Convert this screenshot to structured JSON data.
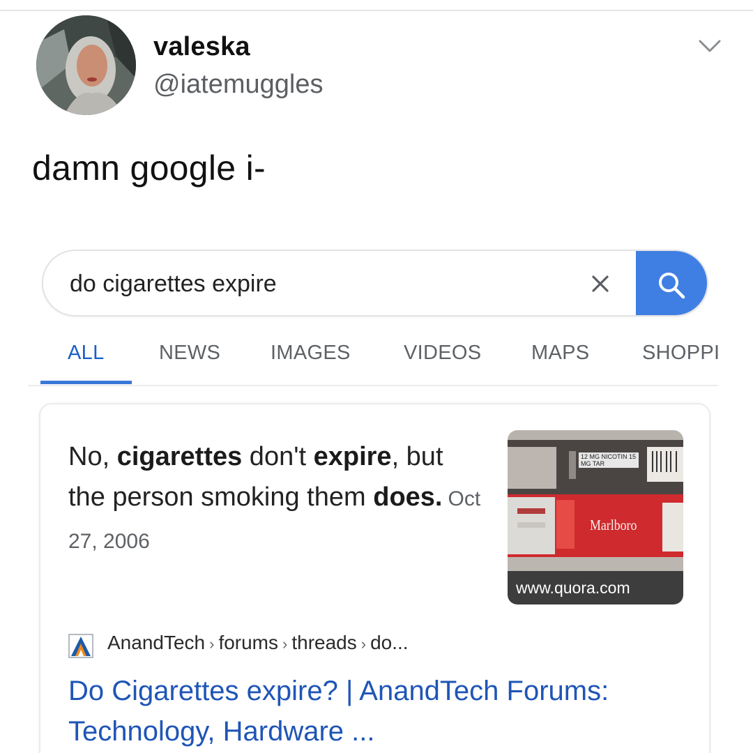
{
  "tweet": {
    "display_name": "valeska",
    "handle": "@iatemuggles",
    "text": "damn google i-"
  },
  "search": {
    "query": "do cigarettes expire",
    "clear_icon": "close-icon",
    "search_icon": "search-icon",
    "accent_color": "#3f7fe3"
  },
  "tabs": [
    {
      "label": "ALL",
      "active": true
    },
    {
      "label": "NEWS",
      "active": false
    },
    {
      "label": "IMAGES",
      "active": false
    },
    {
      "label": "VIDEOS",
      "active": false
    },
    {
      "label": "MAPS",
      "active": false
    },
    {
      "label": "SHOPPI",
      "active": false
    }
  ],
  "featured_snippet": {
    "answer_part1": "No, ",
    "answer_bold1": "cigarettes",
    "answer_part2": " don't ",
    "answer_bold2": "expire",
    "answer_part3": ", but the person smoking them ",
    "answer_bold3": "does.",
    "date": "Oct 27, 2006",
    "image_caption": "www.quora.com",
    "image_brand": "Marlboro",
    "image_warning": "12 MG NICOTIN 15 MG TAR"
  },
  "result": {
    "breadcrumb": [
      "AnandTech",
      "forums",
      "threads",
      "do..."
    ],
    "title_line1": "Do Cigarettes expire? | AnandTech Forums:",
    "title_line2": "Technology, Hardware ...",
    "link_color": "#1f55b6"
  }
}
